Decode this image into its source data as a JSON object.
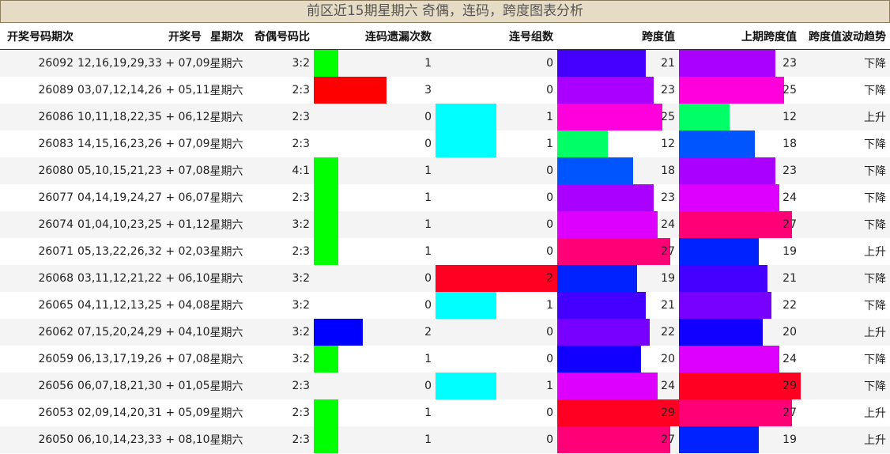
{
  "title": "前区近15期星期六 奇偶，连码，跨度图表分析",
  "headers": [
    "开奖号码期次",
    "开奖号",
    "星期次",
    "奇偶号码比",
    "连码遗漏次数",
    "连号组数",
    "跨度值",
    "上期跨度值",
    "跨度值波动趋势"
  ],
  "scales": {
    "miss_max": 5,
    "group_max": 2,
    "span_max": 29
  },
  "rows": [
    {
      "issue": "26092",
      "numbers": "12,16,19,29,33 + 07,09",
      "weekday": "星期六",
      "odd_even": "3:2",
      "miss": "1",
      "groups": "0",
      "span": "21",
      "prev_span": "23",
      "trend": "下降"
    },
    {
      "issue": "26089",
      "numbers": "03,07,12,14,26 + 05,11",
      "weekday": "星期六",
      "odd_even": "2:3",
      "miss": "3",
      "groups": "0",
      "span": "23",
      "prev_span": "25",
      "trend": "下降"
    },
    {
      "issue": "26086",
      "numbers": "10,11,18,22,35 + 06,12",
      "weekday": "星期六",
      "odd_even": "2:3",
      "miss": "0",
      "groups": "1",
      "span": "25",
      "prev_span": "12",
      "trend": "上升"
    },
    {
      "issue": "26083",
      "numbers": "14,15,16,23,26 + 07,09",
      "weekday": "星期六",
      "odd_even": "2:3",
      "miss": "0",
      "groups": "1",
      "span": "12",
      "prev_span": "18",
      "trend": "下降"
    },
    {
      "issue": "26080",
      "numbers": "05,10,15,21,23 + 07,08",
      "weekday": "星期六",
      "odd_even": "4:1",
      "miss": "1",
      "groups": "0",
      "span": "18",
      "prev_span": "23",
      "trend": "下降"
    },
    {
      "issue": "26077",
      "numbers": "04,14,19,24,27 + 06,07",
      "weekday": "星期六",
      "odd_even": "2:3",
      "miss": "1",
      "groups": "0",
      "span": "23",
      "prev_span": "24",
      "trend": "下降"
    },
    {
      "issue": "26074",
      "numbers": "01,04,10,23,25 + 01,12",
      "weekday": "星期六",
      "odd_even": "3:2",
      "miss": "1",
      "groups": "0",
      "span": "24",
      "prev_span": "27",
      "trend": "下降"
    },
    {
      "issue": "26071",
      "numbers": "05,13,22,26,32 + 02,03",
      "weekday": "星期六",
      "odd_even": "2:3",
      "miss": "1",
      "groups": "0",
      "span": "27",
      "prev_span": "19",
      "trend": "上升"
    },
    {
      "issue": "26068",
      "numbers": "03,11,12,21,22 + 06,10",
      "weekday": "星期六",
      "odd_even": "3:2",
      "miss": "0",
      "groups": "2",
      "span": "19",
      "prev_span": "21",
      "trend": "下降"
    },
    {
      "issue": "26065",
      "numbers": "04,11,12,13,25 + 04,08",
      "weekday": "星期六",
      "odd_even": "3:2",
      "miss": "0",
      "groups": "1",
      "span": "21",
      "prev_span": "22",
      "trend": "下降"
    },
    {
      "issue": "26062",
      "numbers": "07,15,20,24,29 + 04,10",
      "weekday": "星期六",
      "odd_even": "3:2",
      "miss": "2",
      "groups": "0",
      "span": "22",
      "prev_span": "20",
      "trend": "上升"
    },
    {
      "issue": "26059",
      "numbers": "06,13,17,19,26 + 07,08",
      "weekday": "星期六",
      "odd_even": "3:2",
      "miss": "1",
      "groups": "0",
      "span": "20",
      "prev_span": "24",
      "trend": "下降"
    },
    {
      "issue": "26056",
      "numbers": "06,07,18,21,30 + 01,05",
      "weekday": "星期六",
      "odd_even": "2:3",
      "miss": "0",
      "groups": "1",
      "span": "24",
      "prev_span": "29",
      "trend": "下降"
    },
    {
      "issue": "26053",
      "numbers": "02,09,14,20,31 + 05,09",
      "weekday": "星期六",
      "odd_even": "2:3",
      "miss": "1",
      "groups": "0",
      "span": "29",
      "prev_span": "27",
      "trend": "上升"
    },
    {
      "issue": "26050",
      "numbers": "06,10,14,23,33 + 08,10",
      "weekday": "星期六",
      "odd_even": "2:3",
      "miss": "1",
      "groups": "0",
      "span": "27",
      "prev_span": "19",
      "trend": "上升"
    }
  ],
  "colors": {
    "miss": {
      "1": "#00ff00",
      "2": "#0000ff",
      "3": "#ff0000"
    },
    "groups": {
      "1": "#00ffff",
      "2": "#ff0022"
    },
    "span": {
      "12": "#00ff66",
      "18": "#0055ff",
      "19": "#0022ff",
      "20": "#1100ff",
      "21": "#4400ff",
      "22": "#7700ff",
      "23": "#aa00ff",
      "24": "#dd00ff",
      "25": "#ff00dd",
      "27": "#ff0077",
      "29": "#ff0022"
    }
  }
}
